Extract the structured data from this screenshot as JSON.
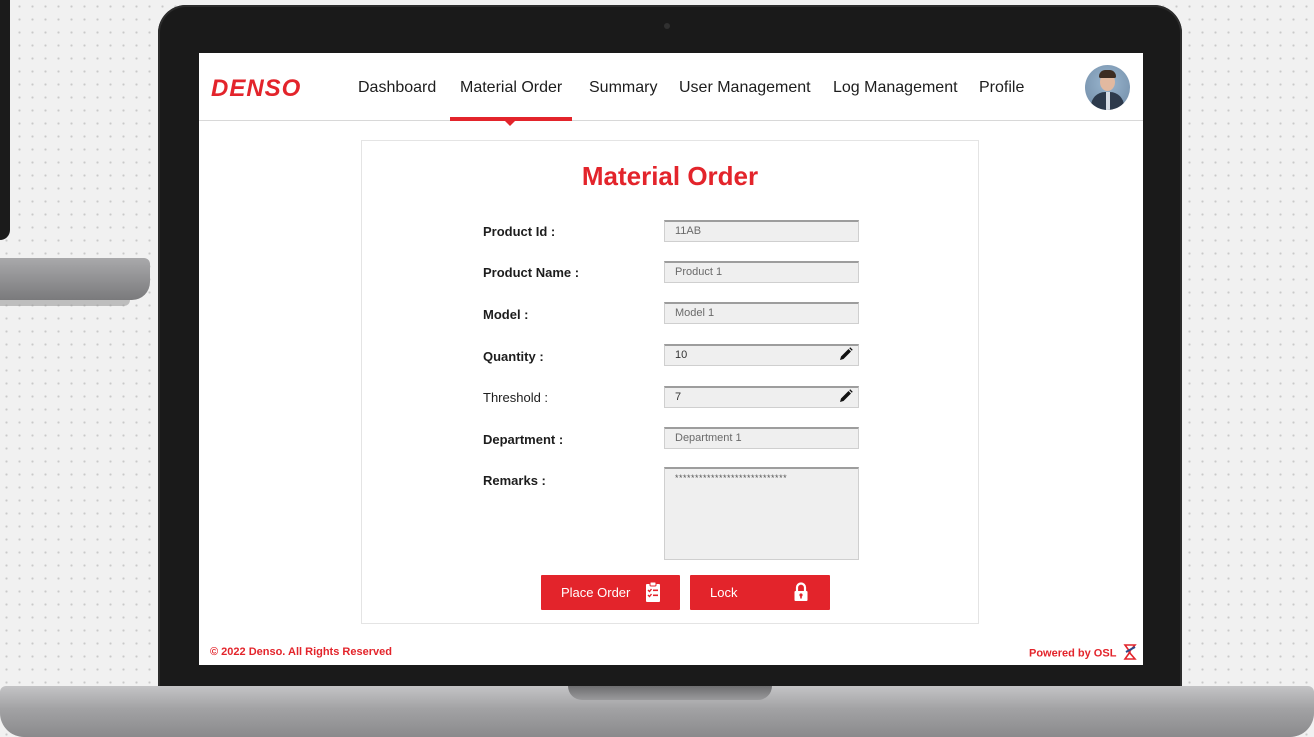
{
  "app": {
    "logo_text": "DENSO",
    "brand_color": "#e3242b"
  },
  "nav": {
    "items": [
      {
        "label": "Dashboard"
      },
      {
        "label": "Material Order"
      },
      {
        "label": "Summary"
      },
      {
        "label": "User Management"
      },
      {
        "label": "Log Management"
      },
      {
        "label": "Profile"
      }
    ],
    "active": "Material Order"
  },
  "form": {
    "title": "Material Order",
    "fields": [
      {
        "label": "Product Id :",
        "value": "11AB"
      },
      {
        "label": "Product Name :",
        "value": "Product 1"
      },
      {
        "label": "Model :",
        "value": "Model 1"
      },
      {
        "label": "Quantity :",
        "value": "10",
        "icon": "pencil-icon"
      },
      {
        "label": "Threshold :",
        "value": "7",
        "icon": "pencil-icon"
      },
      {
        "label": "Department :",
        "value": "Department 1"
      }
    ],
    "remarks": {
      "label": "Remarks :",
      "value": "****************************"
    },
    "buttons": {
      "place_order": {
        "label": "Place Order",
        "icon": "clipboard-checklist-icon"
      },
      "lock": {
        "label": "Lock",
        "icon": "padlock-icon"
      }
    }
  },
  "footer": {
    "copyright": "© 2022 Denso. All Rights Reserved",
    "powered_by": "Powered by OSL"
  }
}
